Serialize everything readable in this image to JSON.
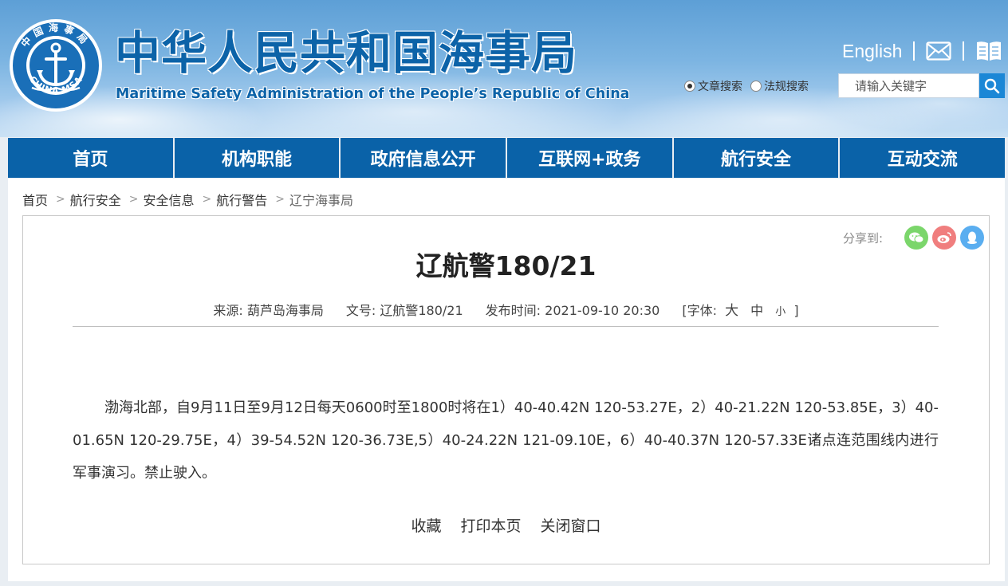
{
  "header": {
    "title_cn": "中华人民共和国海事局",
    "title_en": "Maritime Safety Administration of the People’s Republic of China",
    "logo_text_top": "中国海事局",
    "logo_text_bottom": "CHINA MSA",
    "english_link": "English",
    "mail_icon": "mail-icon",
    "book_icon": "book-icon",
    "search": {
      "options": [
        "文章搜索",
        "法规搜索"
      ],
      "selected": "文章搜索",
      "placeholder": "请输入关键字"
    }
  },
  "nav": {
    "items": [
      "首页",
      "机构职能",
      "政府信息公开",
      "互联网+政务",
      "航行安全",
      "互动交流"
    ]
  },
  "breadcrumb": [
    "首页",
    "航行安全",
    "安全信息",
    "航行警告",
    "辽宁海事局"
  ],
  "share": {
    "label": "分享到:",
    "icons": [
      "wechat-icon",
      "weibo-icon",
      "qq-icon"
    ]
  },
  "article": {
    "title": "辽航警180/21",
    "source_label": "来源:",
    "source": "葫芦岛海事局",
    "doc_label": "文号:",
    "doc_no": "辽航警180/21",
    "time_label": "发布时间:",
    "time": "2021-09-10 20:30",
    "font_label": "[字体:",
    "font_large": "大",
    "font_medium": "中",
    "font_small": "小",
    "font_close": "]",
    "body": "渤海北部，自9月11日至9月12日每天0600时至1800时将在1）40-40.42N 120-53.27E，2）40-21.22N 120-53.85E，3）40-01.65N 120-29.75E，4）39-54.52N 120-36.73E,5）40-24.22N 121-09.10E，6）40-40.37N 120-57.33E诸点连范围线内进行军事演习。禁止驶入。"
  },
  "actions": [
    "收藏",
    "打印本页",
    "关闭窗口"
  ],
  "colors": {
    "brand_blue": "#0a62a8",
    "search_button": "#1b87d6",
    "wechat": "#7bd66b",
    "weibo": "#f07e7e",
    "qq": "#5aaef0"
  }
}
